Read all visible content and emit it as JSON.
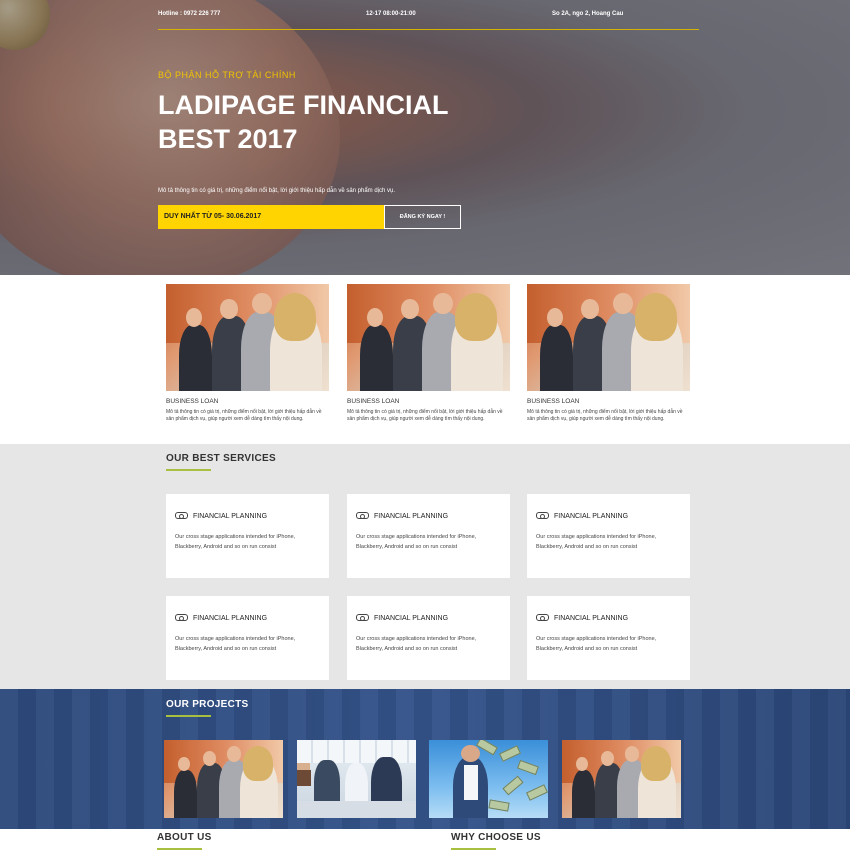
{
  "hero": {
    "hotline": "Hotline : 0972 226 777",
    "hours": "12-17 08:00-21:00",
    "address": "So 2A, ngo 2, Hoang Cau",
    "subtitle": "BỘ PHẬN HỖ TRỢ TÀI CHÍNH",
    "title_line1": "LADIPAGE FINANCIAL",
    "title_line2": "BEST 2017",
    "description": "Mô tả thông tin có giá trị, những điểm nổi bật, lời giới thiệu hấp dẫn về sản phẩm dịch vụ.",
    "promo": "DUY NHẤT TỪ 05- 30.06.2017",
    "cta_label": "ĐĂNG KÝ NGAY !",
    "accent_color": "#ffd400"
  },
  "loans": [
    {
      "title": "BUSINESS LOAN",
      "desc": "Mô tả thông tin có giá trị, những điểm nổi bật, lời giới thiệu hấp dẫn về sản phẩm dịch vụ, giúp người xem dễ dàng tìm thấy nội dung."
    },
    {
      "title": "BUSINESS LOAN",
      "desc": "Mô tả thông tin có giá trị, những điểm nổi bật, lời giới thiệu hấp dẫn về sản phẩm dịch vụ, giúp người xem dễ dàng tìm thấy nội dung."
    },
    {
      "title": "BUSINESS LOAN",
      "desc": "Mô tả thông tin có giá trị, những điểm nổi bật, lời giới thiệu hấp dẫn về sản phẩm dịch vụ, giúp người xem dễ dàng tìm thấy nội dung."
    }
  ],
  "services": {
    "title": "OUR BEST SERVICES",
    "items": [
      {
        "title": "FINANCIAL PLANNING",
        "desc": "Our cross stage applications intended for iPhone, Blackberry, Android and so on run consist",
        "icon": "gamepad-icon"
      },
      {
        "title": "FINANCIAL PLANNING",
        "desc": "Our cross stage applications intended for iPhone, Blackberry, Android and so on run consist",
        "icon": "gamepad-icon"
      },
      {
        "title": "FINANCIAL PLANNING",
        "desc": "Our cross stage applications intended for iPhone, Blackberry, Android and so on run consist",
        "icon": "gamepad-icon"
      },
      {
        "title": "FINANCIAL PLANNING",
        "desc": "Our cross stage applications intended for iPhone, Blackberry, Android and so on run consist",
        "icon": "gamepad-icon"
      },
      {
        "title": "FINANCIAL PLANNING",
        "desc": "Our cross stage applications intended for iPhone, Blackberry, Android and so on run consist",
        "icon": "gamepad-icon"
      },
      {
        "title": "FINANCIAL PLANNING",
        "desc": "Our cross stage applications intended for iPhone, Blackberry, Android and so on run consist",
        "icon": "gamepad-icon"
      }
    ]
  },
  "projects": {
    "title": "OUR PROJECTS",
    "background_color": "#2d4a7c"
  },
  "about": {
    "title": "ABOUT US"
  },
  "why": {
    "title": "WHY CHOOSE US"
  }
}
